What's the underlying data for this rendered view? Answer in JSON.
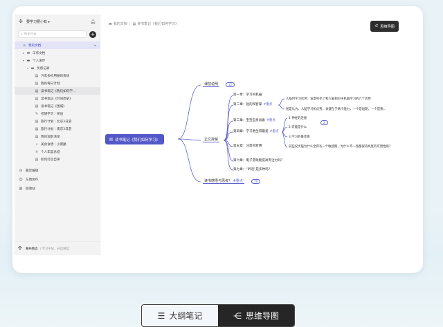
{
  "sidebar": {
    "space_name": "要学习要小有 ▸",
    "search_placeholder": "搜索内容",
    "tree": [
      {
        "label": "我的文档",
        "icon": "home-icon",
        "level": 0,
        "caret": "",
        "active": true
      },
      {
        "label": "工作文档",
        "icon": "folder-icon",
        "level": 1,
        "caret": "▸"
      },
      {
        "label": "个人进步",
        "icon": "folder-icon",
        "level": 1,
        "caret": "▾"
      },
      {
        "label": "灵感记录",
        "icon": "folder-icon",
        "level": 2,
        "caret": "▾"
      },
      {
        "label": "汽车多初用随听系统",
        "icon": "doc-icon",
        "level": 3,
        "caret": ""
      },
      {
        "label": "我的每日计划",
        "icon": "doc-icon",
        "level": 3,
        "caret": ""
      },
      {
        "label": "读书笔记《我们如何学...",
        "icon": "doc-icon",
        "level": 3,
        "caret": "",
        "hover": true
      },
      {
        "label": "读书笔记《时间简史》",
        "icon": "doc-icon",
        "level": 3,
        "caret": ""
      },
      {
        "label": "读书笔记《围城》",
        "icon": "doc-icon",
        "level": 3,
        "caret": ""
      },
      {
        "label": "考研学习｜英语",
        "icon": "pen-icon",
        "level": 3,
        "caret": ""
      },
      {
        "label": "旅行计划｜北京3日游",
        "icon": "doc-icon",
        "level": 3,
        "caret": ""
      },
      {
        "label": "旅行计划｜南京3日游",
        "icon": "doc-icon",
        "level": 3,
        "caret": ""
      },
      {
        "label": "我的观影清单",
        "icon": "doc-icon",
        "level": 3,
        "caret": ""
      },
      {
        "label": "美食食谱｜小粥酪",
        "icon": "search-doc-icon",
        "level": 3,
        "caret": ""
      },
      {
        "label": "个人年度总结",
        "icon": "trophy-icon",
        "level": 3,
        "caret": ""
      },
      {
        "label": "如何打造自律",
        "icon": "doc-icon",
        "level": 3,
        "caret": ""
      }
    ],
    "links": [
      {
        "label": "最近编辑",
        "icon": "clock-icon"
      },
      {
        "label": "与我协作",
        "icon": "users-icon"
      },
      {
        "label": "回收站",
        "icon": "trash-icon"
      }
    ],
    "footer_title": "幕布精选",
    "footer_sub": "| 学习干货，开启精读"
  },
  "breadcrumb": {
    "items": [
      "我的文档",
      "读书笔记《我们如何学习》"
    ]
  },
  "toolbar": {
    "mindmap_button": "思维导图"
  },
  "mindmap": {
    "root": "读书笔记《我们如何学习》",
    "l1": [
      {
        "label": "课前说明",
        "badge": "12"
      },
      {
        "label": "正文拆解",
        "badge": ""
      },
      {
        "label": "读书感悟与思考？",
        "tag": "#重点",
        "badge": "79"
      }
    ],
    "l2": [
      {
        "label": "第一章：学习的机器",
        "tag": ""
      },
      {
        "label": "第二章：短的和智谋",
        "tag": "#重点"
      },
      {
        "label": "第三章：宝宝自身具备",
        "tag": "#重点"
      },
      {
        "label": "第四章：学习者生得最爱",
        "tag": "#重点"
      },
      {
        "label": "第五章：注意的新用",
        "tag": ""
      },
      {
        "label": "第六章：电子游戏能提高专注力吗?",
        "tag": ""
      },
      {
        "label": "第七章：“听话”是多种吗？",
        "tag": ""
      }
    ],
    "l3": [
      "人脑时学习优势：该章列举了和人脑相对于机器学习的六个优势",
      "爸是认为，人脑学习机优势，关键在于两个能力，一个是短期，一个是我...",
      "1.神经的连接",
      "2.可能是什么",
      "3.学习的最佳期",
      "前些说大脑为什么全得有一个敏感期，为什么不一直都保持高度的可塑性呢?"
    ],
    "l3_badge": "2"
  },
  "bottom_toggle": {
    "outline_label": "大纲笔记",
    "mindmap_label": "思维导图",
    "active": "mindmap"
  },
  "colors": {
    "accent": "#5257c8",
    "dark": "#262626"
  }
}
